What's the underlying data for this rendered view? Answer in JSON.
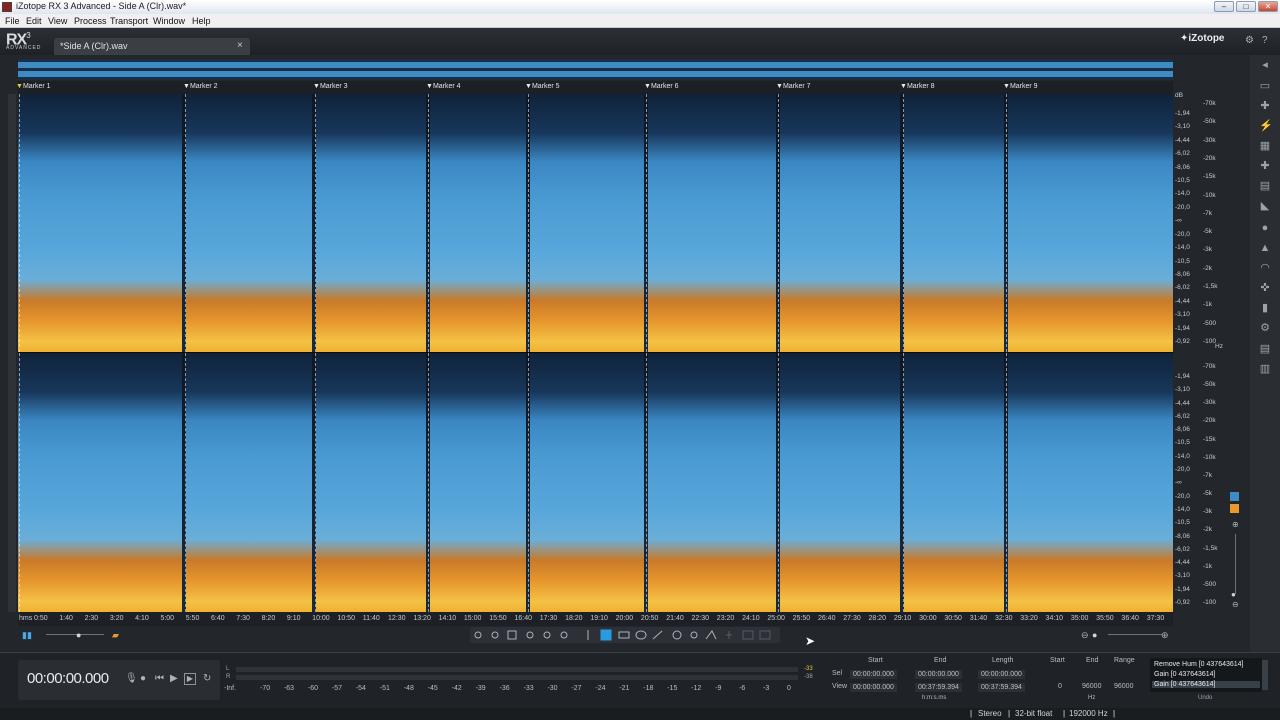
{
  "window": {
    "title": "iZotope RX 3 Advanced - Side A (Clr).wav*",
    "controls": [
      "–",
      "□",
      "✕"
    ]
  },
  "menu": [
    "File",
    "Edit",
    "View",
    "Process",
    "Transport",
    "Window",
    "Help"
  ],
  "app": {
    "logo_text": "RX",
    "logo_version": "3",
    "logo_sub": "ADVANCED",
    "brand": "iZotope",
    "tab_label": "*Side A (Clr).wav",
    "tab_close": "×"
  },
  "markers": [
    {
      "label": "Marker 1",
      "selected": true
    },
    {
      "label": "Marker 2",
      "selected": false
    },
    {
      "label": "Marker 3",
      "selected": false
    },
    {
      "label": "Marker 4",
      "selected": false
    },
    {
      "label": "Marker 5",
      "selected": false
    },
    {
      "label": "Marker 6",
      "selected": false
    },
    {
      "label": "Marker 7",
      "selected": false
    },
    {
      "label": "Marker 8",
      "selected": false
    },
    {
      "label": "Marker 9",
      "selected": false
    }
  ],
  "scale": {
    "db_unit": "dB",
    "hz_unit": "Hz",
    "top_db": [
      "-1,94",
      "-3,10",
      "-4,44",
      "-6,02",
      "-8,06",
      "-10,5",
      "-14,0",
      "-20,0",
      "-∞",
      "-20,0",
      "-14,0",
      "-10,5",
      "-8,06",
      "-6,02",
      "-4,44",
      "-3,10",
      "-1,94",
      "-0,92"
    ],
    "top_hz": [
      "-70k",
      "-50k",
      "-30k",
      "-20k",
      "-15k",
      "-10k",
      "-7k",
      "-5k",
      "-3k",
      "-2k",
      "-1,5k",
      "-1k",
      "-500",
      "-100"
    ],
    "bottom_db": [
      "-1,94",
      "-3,10",
      "-4,44",
      "-6,02",
      "-8,06",
      "-10,5",
      "-14,0",
      "-20,0",
      "-∞",
      "-20,0",
      "-14,0",
      "-10,5",
      "-8,06",
      "-6,02",
      "-4,44",
      "-3,10",
      "-1,94",
      "-0,92"
    ],
    "bottom_hz": [
      "-70k",
      "-50k",
      "-30k",
      "-20k",
      "-15k",
      "-10k",
      "-7k",
      "-5k",
      "-3k",
      "-2k",
      "-1,5k",
      "-1k",
      "-500",
      "-100"
    ]
  },
  "timeline": {
    "format": "hms",
    "labels": [
      "0:50",
      "1:40",
      "2:30",
      "3:20",
      "4:10",
      "5:00",
      "5:50",
      "6:40",
      "7:30",
      "8:20",
      "9:10",
      "10:00",
      "10:50",
      "11:40",
      "12:30",
      "13:20",
      "14:10",
      "15:00",
      "15:50",
      "16:40",
      "17:30",
      "18:20",
      "19:10",
      "20:00",
      "20:50",
      "21:40",
      "22:30",
      "23:20",
      "24:10",
      "25:00",
      "25:50",
      "26:40",
      "27:30",
      "28:20",
      "29:10",
      "30:00",
      "30:50",
      "31:40",
      "32:30",
      "33:20",
      "34:10",
      "35:00",
      "35:50",
      "36:40",
      "37:30"
    ]
  },
  "transport": {
    "timecode": "00:00:00.000",
    "buttons": [
      "record-arm",
      "record",
      "rewind",
      "play",
      "play-selection",
      "loop"
    ]
  },
  "meter": {
    "ch_l": "L",
    "ch_r": "R",
    "ticks": [
      "-Inf.",
      "-70",
      "-63",
      "-60",
      "-57",
      "-54",
      "-51",
      "-48",
      "-45",
      "-42",
      "-39",
      "-36",
      "-33",
      "-30",
      "-27",
      "-24",
      "-21",
      "-18",
      "-15",
      "-12",
      "-9",
      "-6",
      "-3",
      "0"
    ],
    "peak_l": "-33",
    "peak_r": "-38"
  },
  "selection": {
    "hdr_start": "Start",
    "hdr_end": "End",
    "hdr_length": "Length",
    "row_sel": "Sel",
    "row_view": "View",
    "sel_start": "00:00:00.000",
    "sel_end": "00:00:00.000",
    "sel_length": "00:00:00.000",
    "view_start": "00:00:00.000",
    "view_end": "00:37:59.394",
    "view_length": "00:37:59.394",
    "time_unit": "h:m:s.ms",
    "freq_hdr_start": "Start",
    "freq_hdr_end": "End",
    "freq_hdr_range": "Range",
    "freq_start": "0",
    "freq_end": "96000",
    "freq_range": "96000",
    "freq_unit": "Hz"
  },
  "history": {
    "items": [
      "Remove Hum [0 437643614]",
      "Gain [0 437643614]",
      "Gain [0 437643614]"
    ],
    "active_index": 2,
    "undo_label": "Undo"
  },
  "status": {
    "channels": "Stereo",
    "bitdepth": "32-bit float",
    "samplerate": "192000 Hz"
  },
  "colors": {
    "spectrum_high": "#f4c246",
    "spectrum_mid": "#4a9ad2",
    "spectrum_low": "#10223a",
    "marker_selected": "#e7c83a"
  }
}
